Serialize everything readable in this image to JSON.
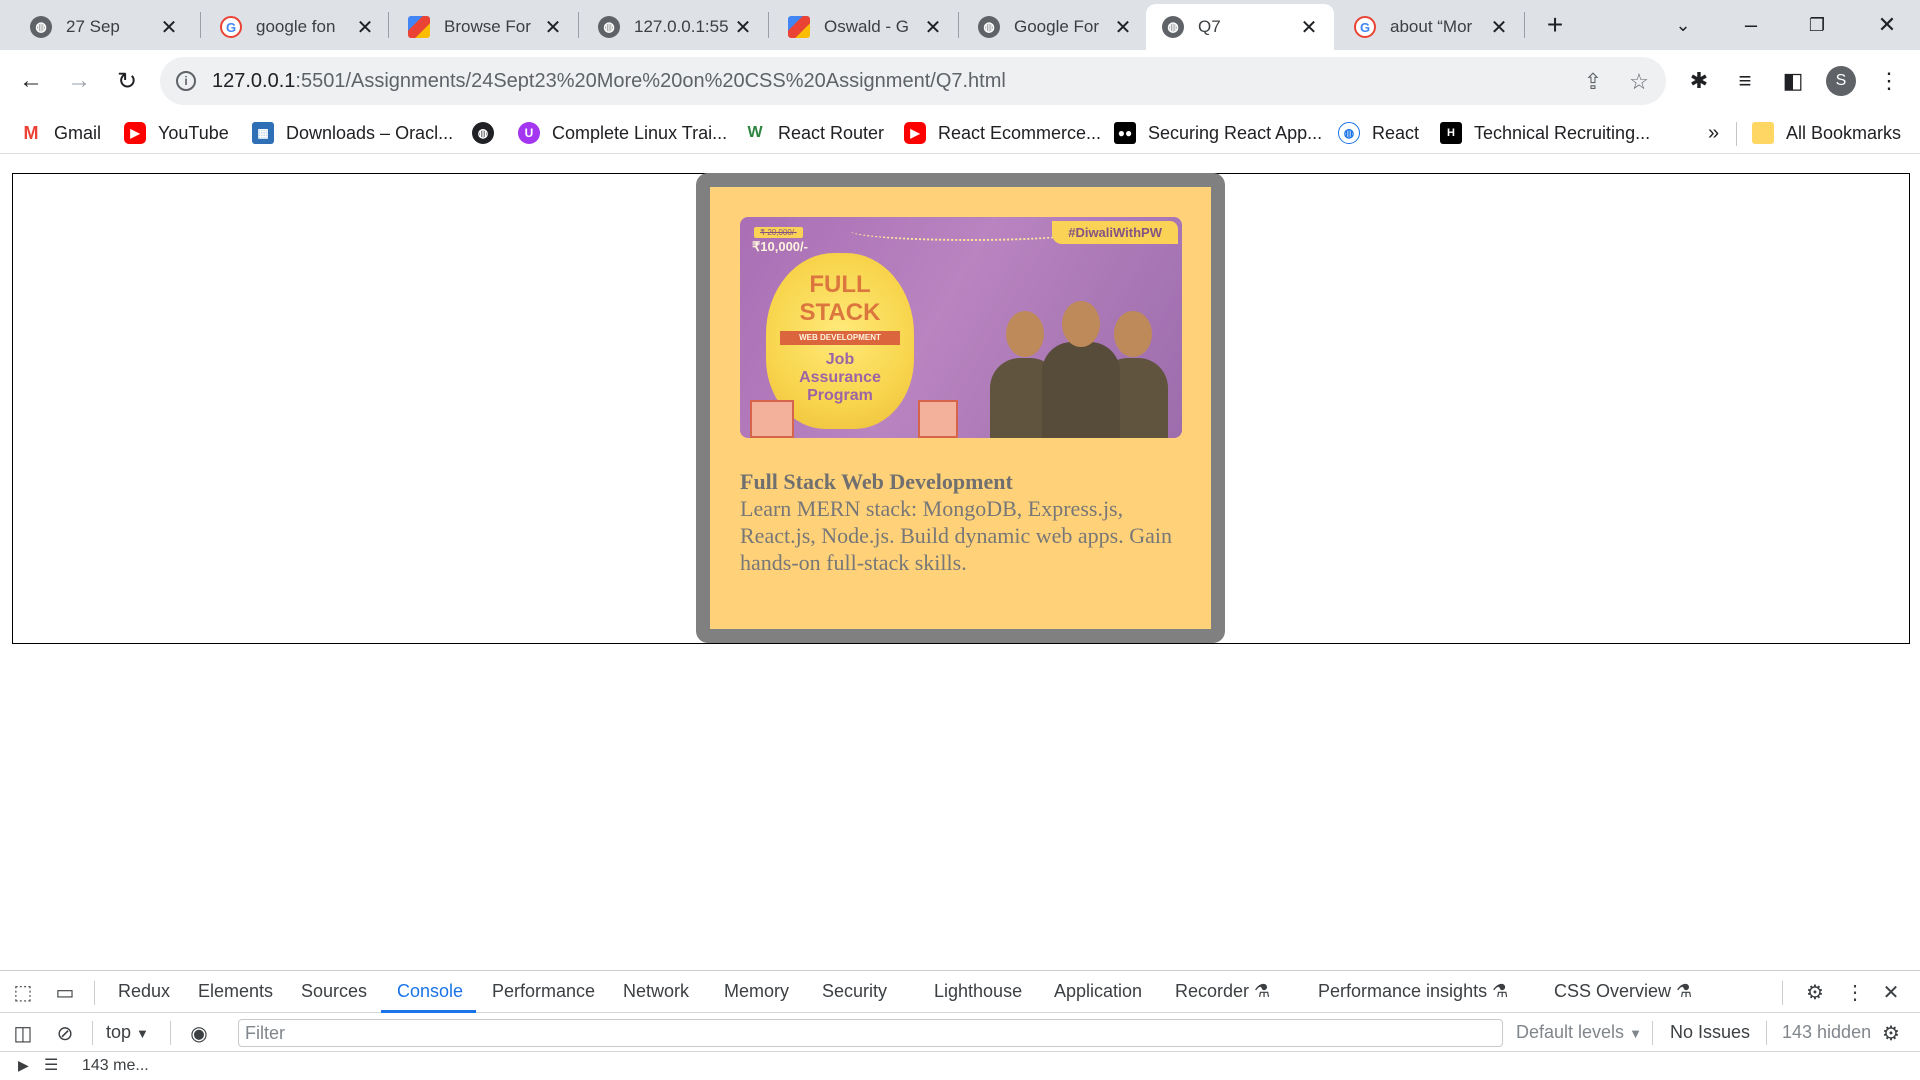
{
  "tabs": [
    {
      "title": "27 Sep",
      "icon": "globe-icon"
    },
    {
      "title": "google fon",
      "icon": "google-icon"
    },
    {
      "title": "Browse For",
      "icon": "google-fonts-icon"
    },
    {
      "title": "127.0.0.1:55",
      "icon": "globe-icon"
    },
    {
      "title": "Oswald - G",
      "icon": "google-fonts-icon"
    },
    {
      "title": "Google For",
      "icon": "globe-icon"
    },
    {
      "title": "Q7",
      "icon": "globe-icon",
      "active": true
    },
    {
      "title": "about “Mor",
      "icon": "google-icon"
    }
  ],
  "toolbar": {
    "url_host": "127.0.0.1",
    "url_path": ":5501/Assignments/24Sept23%20More%20on%20CSS%20Assignment/Q7.html",
    "profile_initial": "S"
  },
  "bookmarks": [
    {
      "label": "Gmail",
      "icon": "gmail-icon"
    },
    {
      "label": "YouTube",
      "icon": "youtube-icon"
    },
    {
      "label": "Downloads – Oracl...",
      "icon": "oracle-icon"
    },
    {
      "label": "",
      "icon": "globe-icon"
    },
    {
      "label": "Complete Linux Trai...",
      "icon": "udemy-icon"
    },
    {
      "label": "React Router",
      "icon": "webflow-icon"
    },
    {
      "label": "React Ecommerce...",
      "icon": "youtube-icon"
    },
    {
      "label": "Securing React App...",
      "icon": "medium-icon"
    },
    {
      "label": "React",
      "icon": "globe-icon"
    },
    {
      "label": "Technical Recruiting...",
      "icon": "hackerrank-icon"
    }
  ],
  "bookmarks_overflow": "»",
  "all_bookmarks": "All Bookmarks",
  "card": {
    "banner": {
      "hashtag": "#DiwaliWithPW",
      "old_price": "₹ 20,000/-",
      "price": "₹10,000/-",
      "headline_1": "FULL",
      "headline_2": "STACK",
      "ribbon": "WEB DEVELOPMENT",
      "sub_1": "Job",
      "sub_2": "Assurance",
      "sub_3": "Program"
    },
    "title": "Full Stack Web Development",
    "description": "Learn MERN stack: MongoDB, Express.js, React.js, Node.js. Build dynamic web apps. Gain hands-on full-stack skills."
  },
  "devtools": {
    "tabs": [
      "Redux",
      "Elements",
      "Sources",
      "Console",
      "Performance",
      "Network",
      "Memory",
      "Security",
      "Lighthouse",
      "Application",
      "Recorder",
      "Performance insights",
      "CSS Overview"
    ],
    "active_tab": "Console",
    "context": "top",
    "filter_placeholder": "Filter",
    "levels": "Default levels",
    "issues": "No Issues",
    "hidden": "143 hidden",
    "messages": "143 me..."
  }
}
